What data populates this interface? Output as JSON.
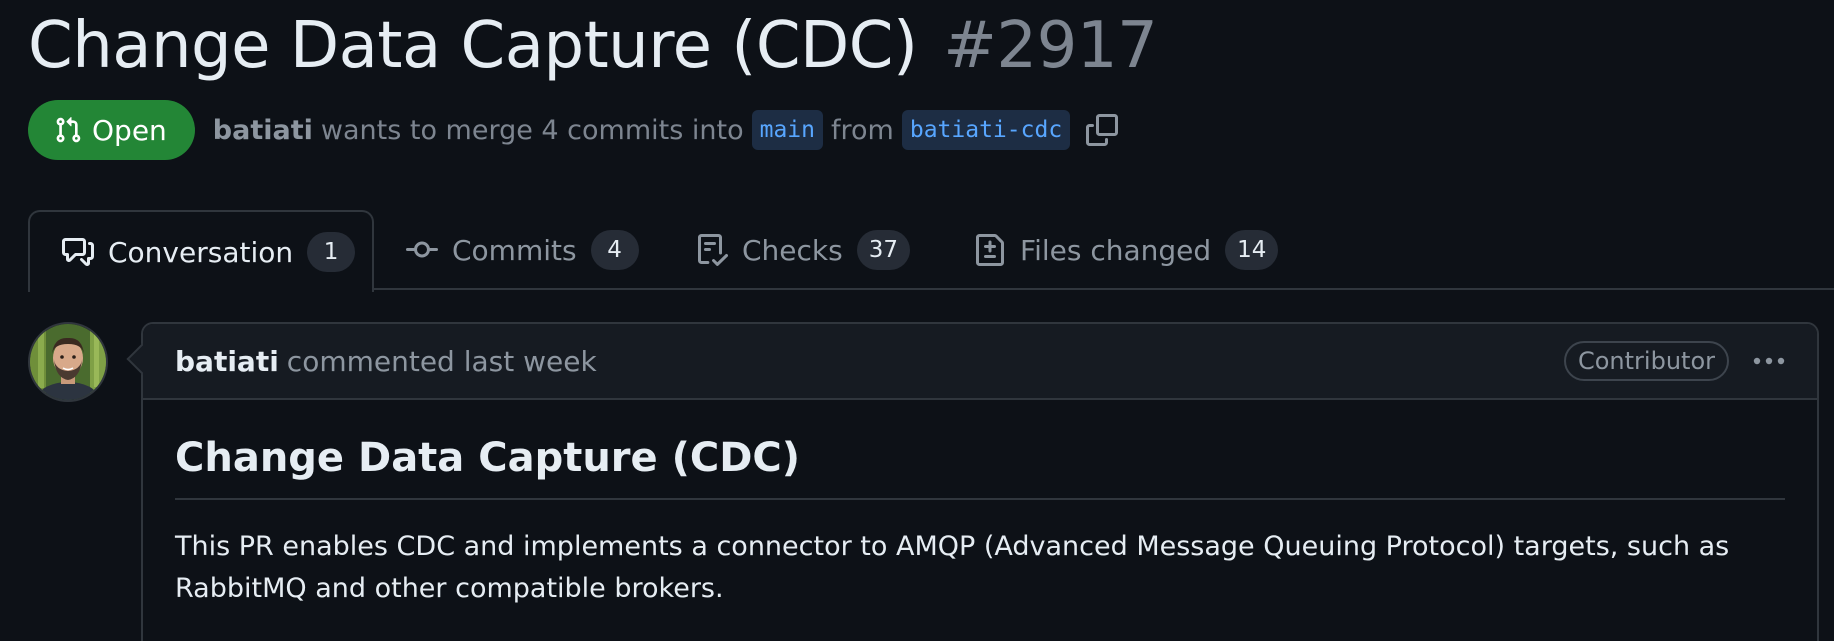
{
  "pr": {
    "title": "Change Data Capture (CDC)",
    "number": "#2917",
    "state": "Open",
    "author": "batiati",
    "merge_text": "wants to merge 4 commits into",
    "base_branch": "main",
    "from_text": "from",
    "head_branch": "batiati-cdc"
  },
  "tabs": [
    {
      "label": "Conversation",
      "count": "1",
      "icon": "comment-discussion-icon",
      "selected": true
    },
    {
      "label": "Commits",
      "count": "4",
      "icon": "git-commit-icon",
      "selected": false
    },
    {
      "label": "Checks",
      "count": "37",
      "icon": "checklist-icon",
      "selected": false
    },
    {
      "label": "Files changed",
      "count": "14",
      "icon": "file-diff-icon",
      "selected": false
    }
  ],
  "comment": {
    "author": "batiati",
    "action": "commented last week",
    "role": "Contributor",
    "heading": "Change Data Capture (CDC)",
    "body": "This PR enables CDC and implements a connector to AMQP (Advanced Message Queuing Protocol) targets, such as RabbitMQ and other compatible brokers."
  },
  "colors": {
    "background": "#0d1117",
    "open_badge": "#238636",
    "branch_text": "#58a6ff",
    "muted_text": "#7d8590",
    "border": "#30363d"
  }
}
